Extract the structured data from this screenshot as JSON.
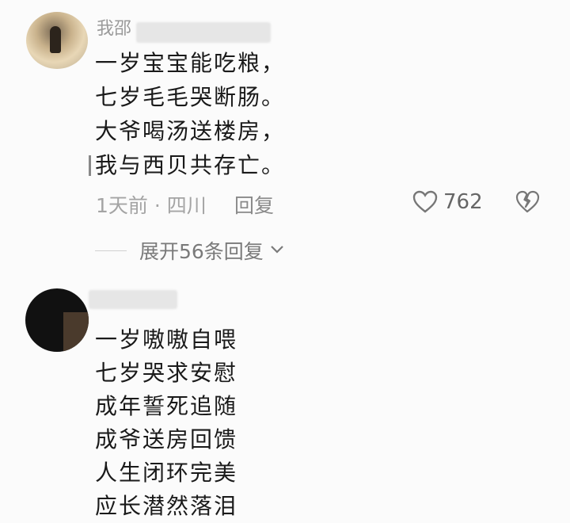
{
  "comments": [
    {
      "username": "我邵",
      "lines": [
        "一岁宝宝能吃粮，",
        "七岁毛毛哭断肠。",
        "大爷喝汤送楼房，",
        "我与西贝共存亡。"
      ],
      "meta": "1天前 · 四川",
      "reply_label": "回复",
      "likes": "762",
      "expand_label": "展开56条回复"
    },
    {
      "username": "",
      "lines": [
        "一岁嗷嗷自喂",
        "七岁哭求安慰",
        "成年誓死追随",
        "成爷送房回馈",
        "人生闭环完美",
        "应长潜然落泪"
      ]
    }
  ]
}
